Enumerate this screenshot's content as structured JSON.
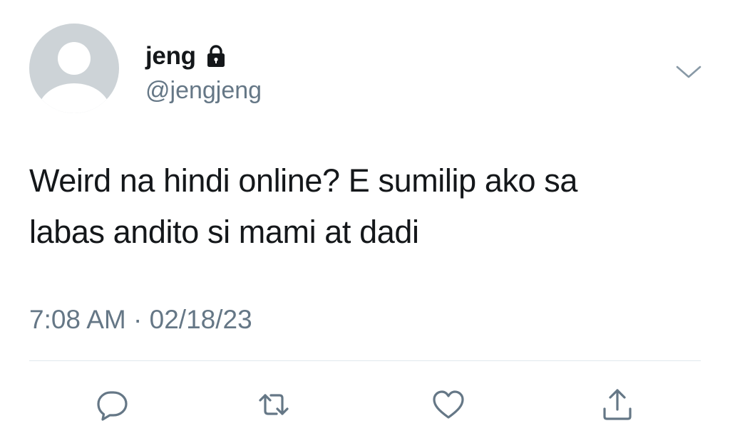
{
  "author": {
    "display_name": "jeng",
    "handle": "@jengjeng",
    "protected": true,
    "avatar": "default-avatar-icon"
  },
  "tweet": {
    "text_lines": [
      "Weird na hindi online? E sumilip ako sa",
      "labas andito si mami at dadi"
    ],
    "time": "7:08 AM",
    "separator": "·",
    "date": "02/18/23"
  },
  "actions": [
    {
      "name": "reply",
      "icon": "reply-icon"
    },
    {
      "name": "retweet",
      "icon": "retweet-icon"
    },
    {
      "name": "like",
      "icon": "heart-icon"
    },
    {
      "name": "share",
      "icon": "share-icon"
    }
  ],
  "colors": {
    "text": "#14171a",
    "secondary": "#657786",
    "icon": "#657786",
    "divider": "#e1e8ed",
    "avatar_bg": "#cdd3d7"
  }
}
